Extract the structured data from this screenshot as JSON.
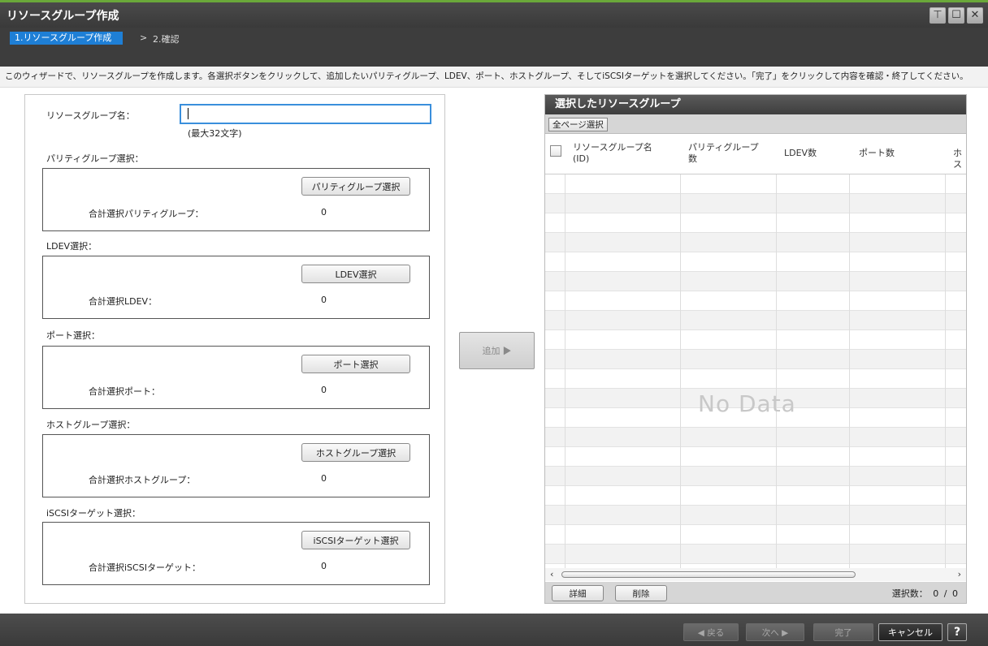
{
  "window": {
    "title": "リソースグループ作成",
    "buttons": [
      "restore-icon",
      "maximize-icon",
      "close-icon"
    ]
  },
  "steps": {
    "active": "1.リソースグループ作成",
    "separator": ">",
    "next": "2.確認"
  },
  "instruction": "このウィザードで、リソースグループを作成します。各選択ボタンをクリックして、追加したいパリティグループ、LDEV、ポート、ホストグループ、そしてiSCSIターゲットを選択してください。「完了」をクリックして内容を確認・終了してください。",
  "form": {
    "name_label": "リソースグループ名：",
    "name_value": "",
    "name_hint": "(最大32文字)",
    "sections": [
      {
        "label": "パリティグループ選択：",
        "button": "パリティグループ選択",
        "total_label": "合計選択パリティグループ：",
        "total_value": "0"
      },
      {
        "label": "LDEV選択：",
        "button": "LDEV選択",
        "total_label": "合計選択LDEV：",
        "total_value": "0"
      },
      {
        "label": "ポート選択：",
        "button": "ポート選択",
        "total_label": "合計選択ポート：",
        "total_value": "0"
      },
      {
        "label": "ホストグループ選択：",
        "button": "ホストグループ選択",
        "total_label": "合計選択ホストグループ：",
        "total_value": "0"
      },
      {
        "label": "iSCSIターゲット選択：",
        "button": "iSCSIターゲット選択",
        "total_label": "合計選択iSCSIターゲット：",
        "total_value": "0"
      }
    ]
  },
  "add_button": "追加 ▶",
  "selected_panel": {
    "title": "選択したリソースグループ",
    "select_all": "全ページ選択",
    "columns": [
      {
        "line1": "リソースグループ名",
        "line2": "(ID)"
      },
      {
        "line1": "パリティグループ",
        "line2": "数"
      },
      {
        "line1": "LDEV数",
        "line2": ""
      },
      {
        "line1": "ポート数",
        "line2": ""
      },
      {
        "line1": "ホス",
        "line2": ""
      }
    ],
    "empty_text": "No Data",
    "scroll_left": "‹",
    "scroll_right": "›",
    "detail_button": "詳細",
    "delete_button": "削除",
    "selection_count": "選択数： 0 / 0"
  },
  "footer": {
    "back": "◀ 戻る",
    "next": "次へ ▶",
    "finish": "完了",
    "cancel": "キャンセル",
    "help": "?"
  }
}
